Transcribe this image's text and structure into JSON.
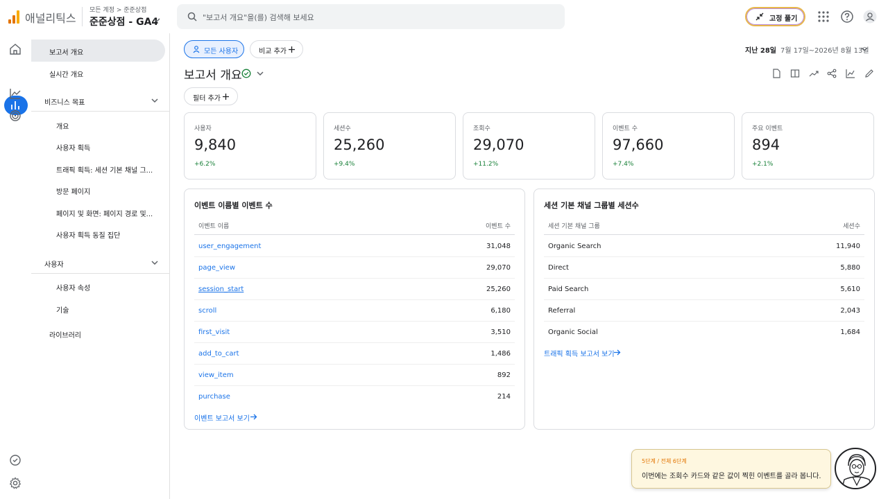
{
  "header": {
    "app_name": "애널리틱스",
    "breadcrumb": "모든 계정 > 준준상점",
    "property": "준준상점 - GA4",
    "search_placeholder": "\"보고서 개요\"을(를) 검색해 보세요",
    "pin_button": "고정 풀기",
    "logo_colors": [
      "#f9ab00",
      "#e37400",
      "#e37400"
    ]
  },
  "rail": {
    "icons": [
      "home-icon",
      "reports-icon",
      "explore-icon",
      "advertising-icon",
      "insights-icon",
      "settings-icon"
    ]
  },
  "nav": {
    "items": [
      {
        "label": "보고서 개요"
      },
      {
        "label": "실시간 개요"
      }
    ],
    "sections": [
      {
        "label": "비즈니스 목표",
        "items": [
          "개요",
          "사용자 획득",
          "트래픽 획득: 세션 기본 채널 그...",
          "방문 페이지",
          "페이지 및 화면: 페이지 경로 및...",
          "사용자 획득 동질 집단"
        ]
      },
      {
        "label": "사용자",
        "items": [
          "사용자 속성",
          "기술"
        ]
      }
    ],
    "library": "라이브러리"
  },
  "toolbar": {
    "all_users": "모든 사용자",
    "add_compare": "비교 추가",
    "date_label": "지난 28일",
    "date_range": "7월 17일~2026년 8월 13일",
    "title": "보고서 개요",
    "add_filter": "필터 추가"
  },
  "kpis": [
    {
      "label": "사용자",
      "value": "9,840",
      "delta": "+6.2%"
    },
    {
      "label": "세션수",
      "value": "25,260",
      "delta": "+9.4%"
    },
    {
      "label": "조회수",
      "value": "29,070",
      "delta": "+11.2%"
    },
    {
      "label": "이벤트 수",
      "value": "97,660",
      "delta": "+7.4%"
    },
    {
      "label": "주요 이벤트",
      "value": "894",
      "delta": "+2.1%"
    }
  ],
  "events_table": {
    "title": "이벤트 이름별 이벤트 수",
    "col1": "이벤트 이름",
    "col2": "이벤트 수",
    "rows": [
      {
        "name": "user_engagement",
        "value": "31,048"
      },
      {
        "name": "page_view",
        "value": "29,070"
      },
      {
        "name": "session_start",
        "value": "25,260"
      },
      {
        "name": "scroll",
        "value": "6,180"
      },
      {
        "name": "first_visit",
        "value": "3,510"
      },
      {
        "name": "add_to_cart",
        "value": "1,486"
      },
      {
        "name": "view_item",
        "value": "892"
      },
      {
        "name": "purchase",
        "value": "214"
      }
    ],
    "link": "이벤트 보고서 보기"
  },
  "channel_table": {
    "title": "세션 기본 채널 그룹별 세션수",
    "col1": "세션 기본 채널 그룹",
    "col2": "세션수",
    "rows": [
      {
        "name": "Organic Search",
        "value": "11,940"
      },
      {
        "name": "Direct",
        "value": "5,880"
      },
      {
        "name": "Paid Search",
        "value": "5,610"
      },
      {
        "name": "Referral",
        "value": "2,043"
      },
      {
        "name": "Organic Social",
        "value": "1,684"
      }
    ],
    "link": "트래픽 획득 보고서 보기"
  },
  "tutorial": {
    "step": "5단계 / 전체 6단계",
    "message": "이번에는 조회수 카드와 같은 값이 찍힌 이벤트를 골라 봅니다."
  },
  "colors": {
    "accent": "#1a73e8",
    "positive": "#188038",
    "tip_bg": "#fef7e0",
    "tip_step": "#e37400"
  }
}
